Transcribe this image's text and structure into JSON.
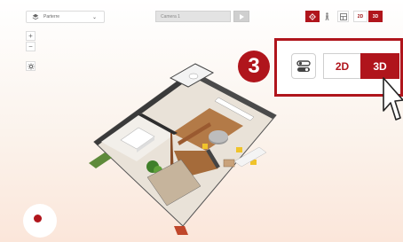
{
  "toolbar": {
    "floor_label": "Parterre",
    "camera_label": "Camera 1",
    "btn_2d": "2D",
    "btn_3d": "3D"
  },
  "zoom": {
    "plus": "+",
    "minus": "−"
  },
  "callout": {
    "step_number": "3",
    "btn_2d": "2D",
    "btn_3d": "3D"
  },
  "colors": {
    "accent": "#b0151c"
  },
  "icons": {
    "floor": "layers-icon",
    "chevron": "chevron-down-icon",
    "play": "play-icon",
    "compass": "compass-icon",
    "person": "person-icon",
    "layout": "layout-icon",
    "settings": "gear-icon",
    "toggle": "toggle-icon",
    "cursor": "cursor-icon"
  }
}
